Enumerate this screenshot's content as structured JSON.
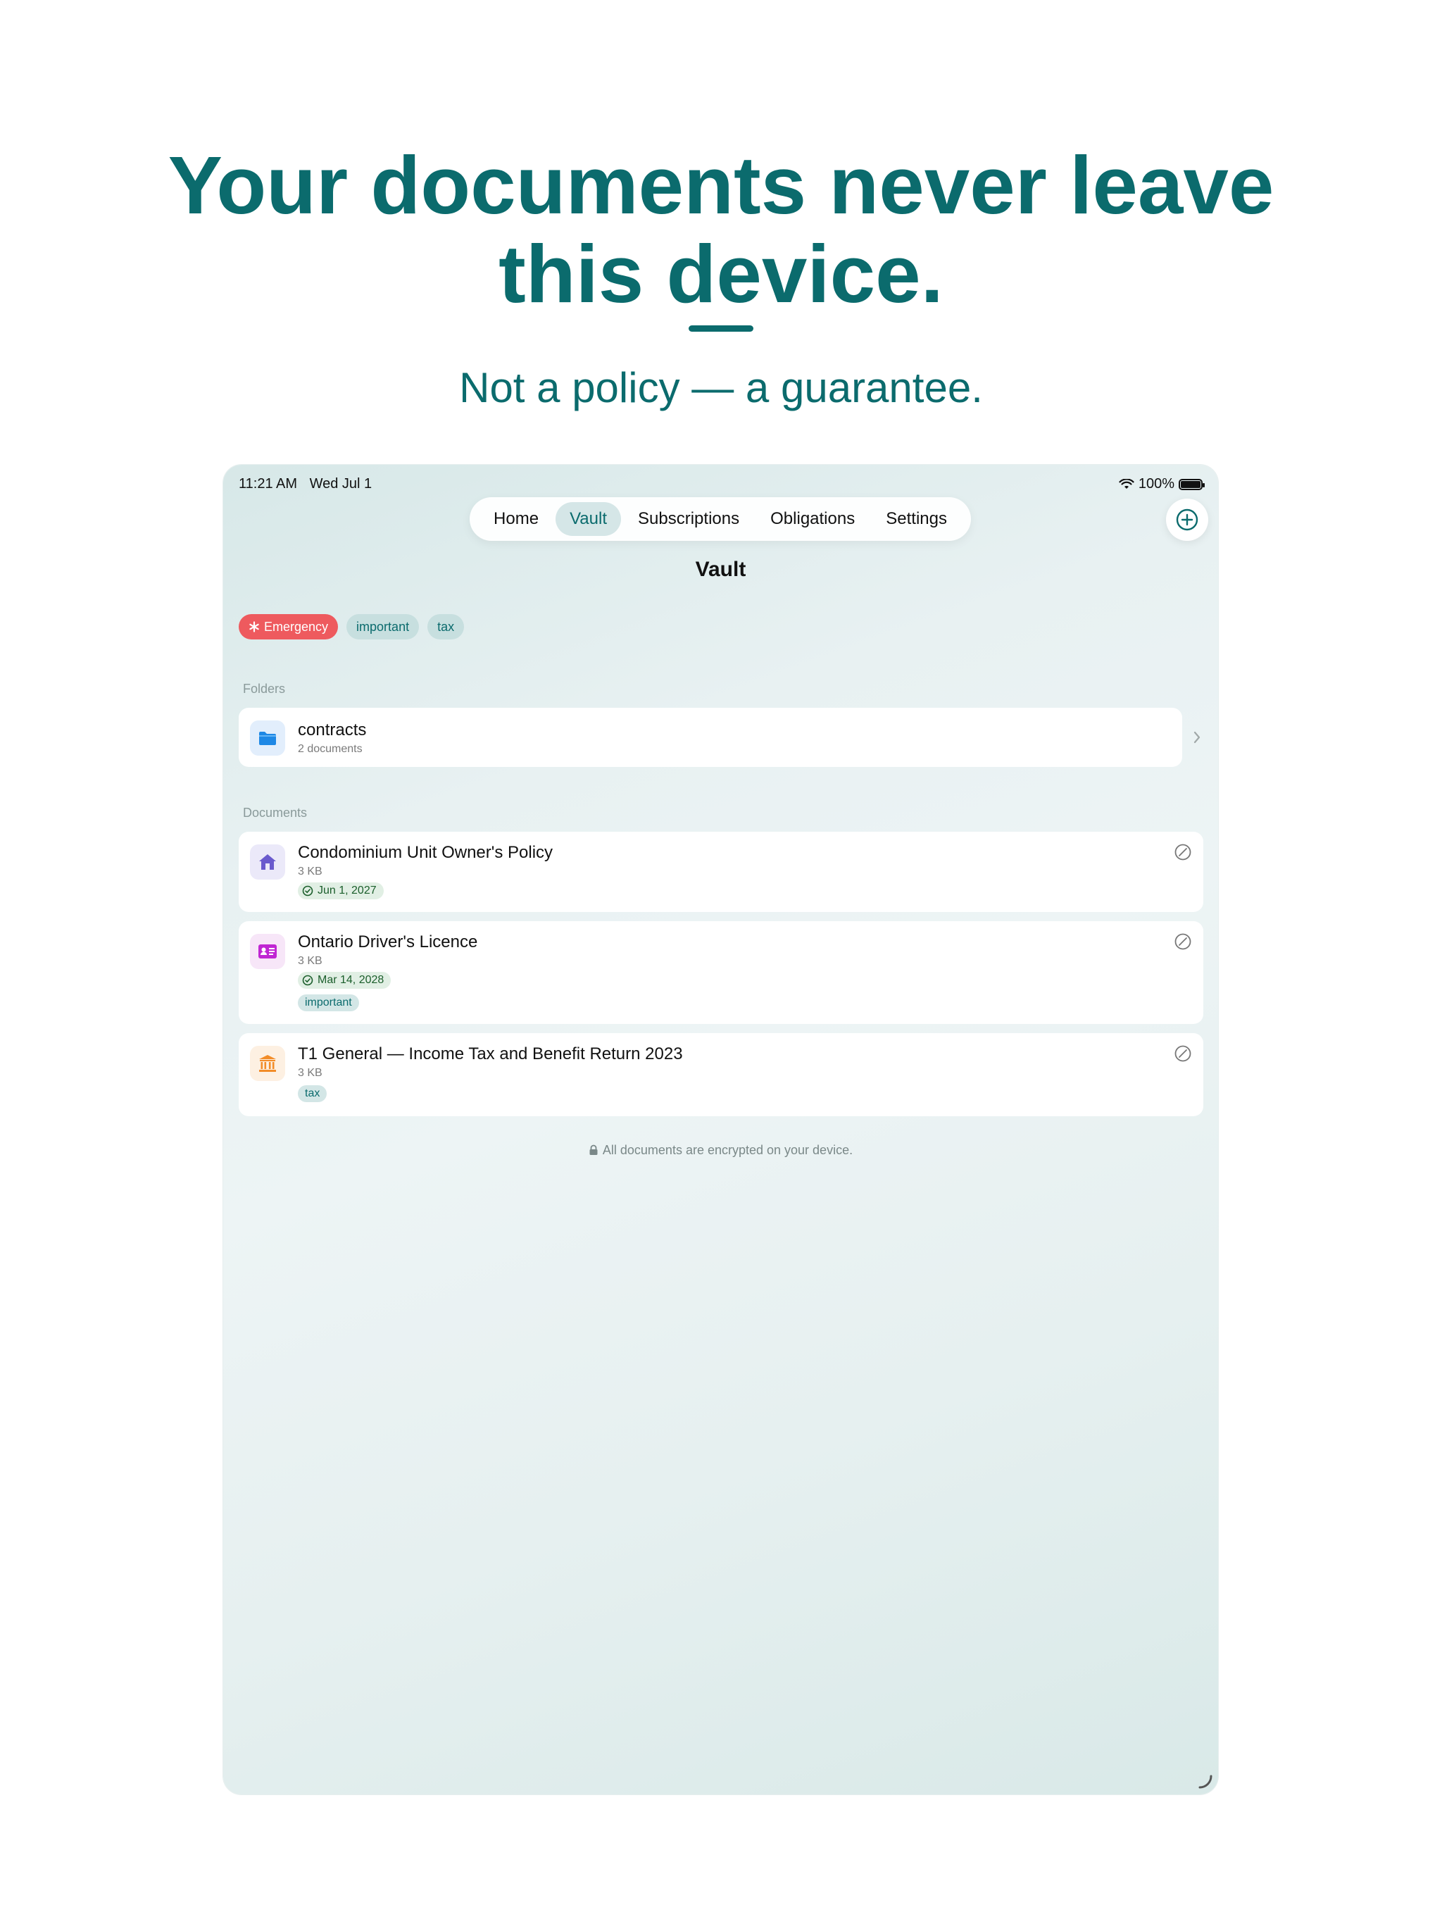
{
  "headline": "Your documents never leave this device.",
  "subhead": "Not a policy — a guarantee.",
  "status_bar": {
    "time": "11:21 AM",
    "date": "Wed Jul 1",
    "battery": "100%"
  },
  "tabs": [
    {
      "label": "Home"
    },
    {
      "label": "Vault"
    },
    {
      "label": "Subscriptions"
    },
    {
      "label": "Obligations"
    },
    {
      "label": "Settings"
    }
  ],
  "active_tab": "Vault",
  "nav_title": "Vault",
  "filter_chips": [
    {
      "label": "Emergency",
      "icon": "asterisk-icon",
      "color": "#ee5a5e"
    },
    {
      "label": "important"
    },
    {
      "label": "tax"
    }
  ],
  "folders_label": "Folders",
  "folders": [
    {
      "name": "contracts",
      "count": "2 documents",
      "icon": "folder-icon"
    }
  ],
  "documents_label": "Documents",
  "documents": [
    {
      "title": "Condominium Unit Owner's Policy",
      "size": "3 KB",
      "date": "Jun 1, 2027",
      "icon": "house-icon"
    },
    {
      "title": "Ontario Driver's Licence",
      "size": "3 KB",
      "date": "Mar 14, 2028",
      "tag": "important",
      "icon": "id-card-icon"
    },
    {
      "title": "T1 General — Income Tax and Benefit Return 2023",
      "size": "3 KB",
      "tag": "tax",
      "icon": "bank-icon"
    }
  ],
  "footer_note": "All documents are encrypted on your device.",
  "colors": {
    "accent": "#0b6b6d",
    "emergency": "#ee5a5e"
  }
}
